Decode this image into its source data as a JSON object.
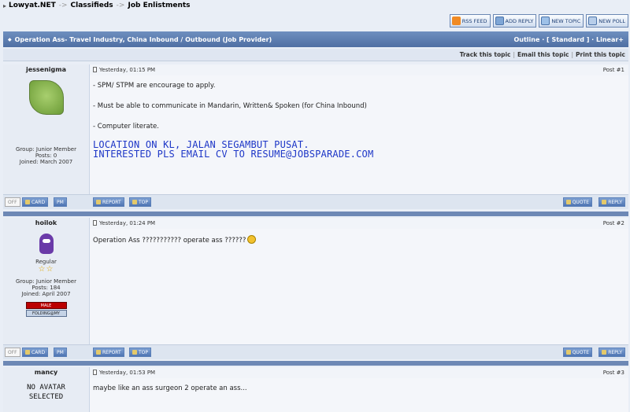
{
  "breadcrumb": {
    "site": "Lowyat.NET",
    "sep": "->",
    "section": "Classifieds",
    "forum": "Job Enlistments"
  },
  "toolbar": {
    "rss": "RSS FEED",
    "addreply": "ADD REPLY",
    "newtopic": "NEW TOPIC",
    "newpoll": "NEW POLL"
  },
  "topic": {
    "title": "Operation Ass- Travel Industry, China Inbound / Outbound (Job Provider)",
    "views": "Outline · [ Standard ] · Linear+"
  },
  "actions": {
    "track": "Track this topic",
    "email": "Email this topic",
    "print": "Print this topic"
  },
  "buttons": {
    "off": "OFF",
    "card": "CARD",
    "pm": "PM",
    "report": "REPORT",
    "top": "TOP",
    "quote": "QUOTE",
    "reply": "REPLY"
  },
  "posts": [
    {
      "author": "jessenigma",
      "time": "Yesterday, 01:15 PM",
      "number": "Post #1",
      "group": "Group: Junior Member",
      "posts": "Posts: 0",
      "joined": "Joined: March 2007",
      "lines": [
        "- SPM/ STPM are encourage to apply.",
        "- Must be able to communicate in Mandarin, Written& Spoken (for China Inbound)",
        "- Computer literate."
      ],
      "highlight1": "LOCATION ON KL, JALAN SEGAMBUT PUSAT.",
      "highlight2": "INTERESTED PLS EMAIL CV TO RESUME@JOBSPARADE.COM"
    },
    {
      "author": "hoilok",
      "time": "Yesterday, 01:24 PM",
      "number": "Post #2",
      "rank": "Regular",
      "group": "Group: Junior Member",
      "posts": "Posts: 184",
      "joined": "Joined: April 2007",
      "badge1": "MALE",
      "badge2": "FOLDING@MY",
      "text": "Operation Ass ??????????? operate ass ??????"
    },
    {
      "author": "mancy",
      "time": "Yesterday, 01:53 PM",
      "number": "Post #3",
      "noavatar1": "NO AVATAR",
      "noavatar2": "SELECTED",
      "text": "maybe like an ass surgeon 2 operate an ass..."
    }
  ]
}
